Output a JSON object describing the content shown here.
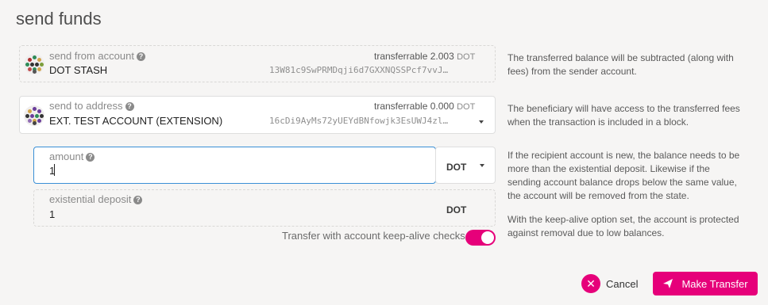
{
  "page": {
    "title": "send funds"
  },
  "from": {
    "label": "send from account",
    "account_name": "DOT STASH",
    "address": "13W81c9SwPRMDqji6d7GXXNQSSPcf7vvJ…",
    "transferrable_label": "transferrable",
    "transferrable_value": "2.003",
    "transferrable_unit": "DOT",
    "help": "The transferred balance will be subtracted (along with fees) from the sender account."
  },
  "to": {
    "label": "send to address",
    "account_name": "EXT. TEST ACCOUNT (EXTENSION)",
    "address": "16cDi9AyMs72yUEYdBNfowjk3EsUWJ4zl…",
    "transferrable_label": "transferrable",
    "transferrable_value": "0.000",
    "transferrable_unit": "DOT",
    "help": "The beneficiary will have access to the transferred fees when the transaction is included in a block."
  },
  "amount": {
    "label": "amount",
    "value": "1",
    "unit": "DOT",
    "help": "If the recipient account is new, the balance needs to be more than the existential deposit. Likewise if the sending account balance drops below the same value, the account will be removed from the state."
  },
  "existential": {
    "label": "existential deposit",
    "value": "1",
    "unit": "DOT"
  },
  "keepalive": {
    "label": "Transfer with account keep-alive checks",
    "enabled": true,
    "help": "With the keep-alive option set, the account is protected against removal due to low balances."
  },
  "actions": {
    "cancel_label": "Cancel",
    "submit_label": "Make Transfer"
  },
  "colors": {
    "accent": "#e6007a",
    "focus": "#3a8fd6"
  }
}
